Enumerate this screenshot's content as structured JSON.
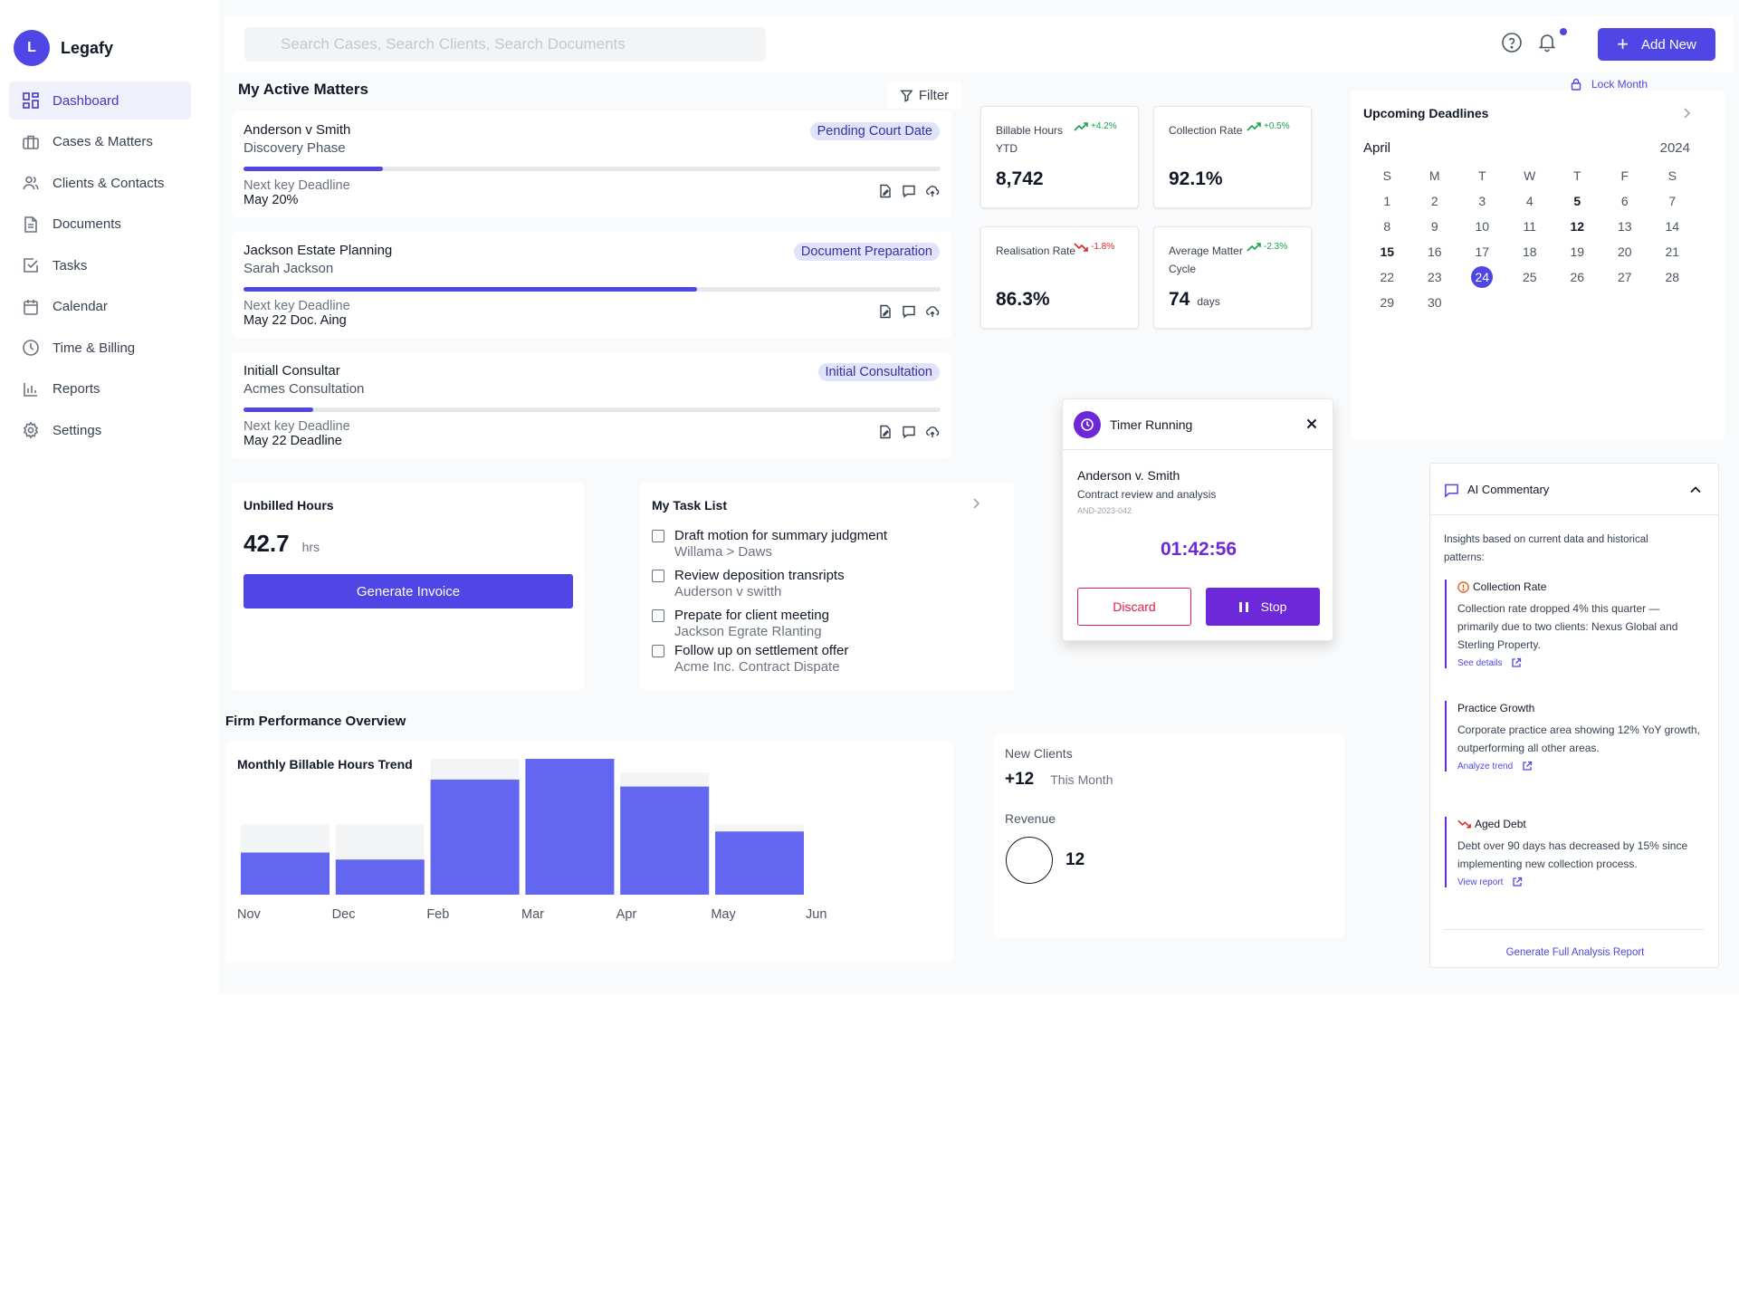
{
  "brand": {
    "initial": "L",
    "name": "Legafy"
  },
  "nav": [
    {
      "label": "Dashboard",
      "icon": "dashboard-icon",
      "active": true
    },
    {
      "label": "Cases & Matters",
      "icon": "briefcase-icon"
    },
    {
      "label": "Clients & Contacts",
      "icon": "users-icon"
    },
    {
      "label": "Documents",
      "icon": "document-icon"
    },
    {
      "label": "Tasks",
      "icon": "check-square-icon"
    },
    {
      "label": "Calendar",
      "icon": "calendar-icon"
    },
    {
      "label": "Time & Billing",
      "icon": "clock-icon"
    },
    {
      "label": "Reports",
      "icon": "bar-chart-icon"
    },
    {
      "label": "Settings",
      "icon": "gear-icon"
    }
  ],
  "header": {
    "search_placeholder": "Search Cases, Search Clients, Search Documents",
    "add_new_label": "Add New",
    "accent_color": "#4f46e5"
  },
  "matters": {
    "title": "My Active Matters",
    "filter_label": "Filter",
    "items": [
      {
        "title": "Anderson v Smith",
        "subtitle": "Discovery Phase",
        "status": "Pending Court Date",
        "progress": 0.2,
        "deadline_label": "Next key Deadline",
        "deadline_value": "May 20%"
      },
      {
        "title": "Jackson Estate Planning",
        "subtitle": "Sarah Jackson",
        "status": "Document Preparation",
        "progress": 0.65,
        "deadline_label": "Next key Deadline",
        "deadline_value": "May 22 Doc. Aing"
      },
      {
        "title": "Initiall Consultar",
        "subtitle": "Acmes Consultation",
        "status": "Initial Consultation",
        "progress": 0.1,
        "deadline_label": "Next key Deadline",
        "deadline_value": "May 22 Deadline"
      }
    ]
  },
  "stats": [
    {
      "label": "Billable Hours YTD",
      "delta": "+4.2%",
      "trend": "up",
      "value": "8,742",
      "unit": ""
    },
    {
      "label": "Collection Rate",
      "delta": "+0.5%",
      "trend": "up",
      "value": "92.1%",
      "unit": ""
    },
    {
      "label": "Realisation Rate",
      "delta": "-1.8%",
      "trend": "down",
      "value": "86.3%",
      "unit": ""
    },
    {
      "label": "Average Matter Cycle",
      "delta": "-2.3%",
      "trend": "up",
      "value": "74",
      "unit": "days"
    }
  ],
  "deadlines": {
    "lock_label": "Lock Month",
    "title": "Upcoming Deadlines",
    "month": "April",
    "year": "2024",
    "weekdays": [
      "S",
      "M",
      "T",
      "W",
      "T",
      "F",
      "S"
    ],
    "days": [
      "1",
      "2",
      "3",
      "4",
      "5",
      "6",
      "7",
      "8",
      "9",
      "10",
      "11",
      "12",
      "13",
      "14",
      "15",
      "16",
      "17",
      "18",
      "19",
      "20",
      "21",
      "22",
      "23",
      "24",
      "25",
      "26",
      "27",
      "28",
      "29",
      "30"
    ],
    "bold_days": [
      "5",
      "12",
      "15"
    ],
    "selected_day": "24"
  },
  "timer": {
    "title": "Timer Running",
    "matter": "Anderson v. Smith",
    "task": "Contract review and analysis",
    "code": "AND-2023-042",
    "elapsed": "01:42:56",
    "discard_label": "Discard",
    "stop_label": "Stop"
  },
  "unbilled": {
    "title": "Unbilled Hours",
    "value": "42.7",
    "unit": "hrs",
    "button_label": "Generate Invoice"
  },
  "tasks": {
    "title": "My Task List",
    "items": [
      {
        "title": "Draft motion for summary judgment",
        "subtitle": "Willama > Daws"
      },
      {
        "title": "Review deposition transripts",
        "subtitle": "Auderson v switth"
      },
      {
        "title": "Prepate for client meeting",
        "subtitle": "Jackson Egrate Rlanting"
      },
      {
        "title": "Follow up on settlement offer",
        "subtitle": "Acme Inc. Contract Dispate"
      }
    ]
  },
  "performance": {
    "title": "Firm Performance Overview"
  },
  "chart_data": {
    "type": "bar",
    "title": "Monthly Billable Hours Trend",
    "categories": [
      "Nov",
      "Dec",
      "Feb",
      "Mar",
      "Apr",
      "May",
      "Jun"
    ],
    "series": [
      {
        "values": [
          30,
          25,
          82,
          100,
          77,
          45
        ],
        "color": "#6366f1"
      },
      {
        "values": [
          50,
          50,
          97,
          100,
          87,
          50
        ],
        "color": "#f3f4f6"
      }
    ],
    "ylim": [
      0,
      100
    ],
    "grid": false
  },
  "clients": {
    "new_label": "New Clients",
    "new_value": "+12",
    "new_period": "This Month",
    "revenue_label": "Revenue",
    "revenue_value": "12"
  },
  "ai": {
    "title": "AI Commentary",
    "intro": "Insights based on current data and historical patterns:",
    "items": [
      {
        "title": "Collection Rate",
        "icon": "alert-circle-icon",
        "text": "Collection rate dropped 4% this quarter — primarily due to two clients: Nexus Global and Sterling Property.",
        "link": "See details"
      },
      {
        "title": "Practice Growth",
        "icon": "",
        "text": "Corporate practice area showing 12% YoY growth, outperforming all other areas.",
        "link": "Analyze trend"
      },
      {
        "title": "Aged Debt",
        "icon": "trend-down-icon",
        "text": "Debt over 90 days has decreased by 15% since implementing new collection process.",
        "link": "View report"
      }
    ],
    "footer_link": "Generate Full Analysis Report"
  }
}
